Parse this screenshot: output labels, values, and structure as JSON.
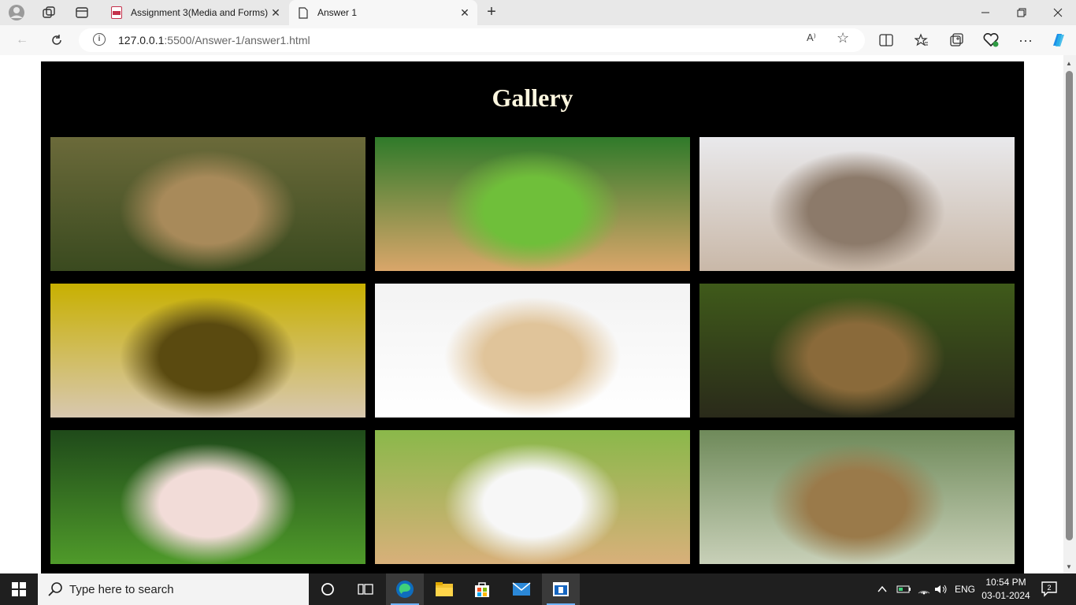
{
  "browser": {
    "tabs": [
      {
        "title": "Assignment 3(Media and Forms)",
        "active": false
      },
      {
        "title": "Answer 1",
        "active": true
      }
    ],
    "url_host": "127.0.0.1",
    "url_rest": ":5500/Answer-1/answer1.html",
    "read_aloud_label": "A⁾"
  },
  "page": {
    "heading": "Gallery",
    "images": [
      {
        "icon": "quokka-photo",
        "colors": [
          "#6b6a3a",
          "#a88a5a",
          "#3a4a1f"
        ]
      },
      {
        "icon": "kitten-in-grass-photo",
        "colors": [
          "#2f7a2a",
          "#6fbf3a",
          "#d9a66a"
        ]
      },
      {
        "icon": "hedgehog-photo",
        "colors": [
          "#e9e9ec",
          "#8c7a6a",
          "#c9b8a8"
        ]
      },
      {
        "icon": "corgi-in-hat-photo",
        "colors": [
          "#c8b000",
          "#5a4a10",
          "#d8c8b0"
        ]
      },
      {
        "icon": "puppy-and-kitten-sleeping-photo",
        "colors": [
          "#f3f3f3",
          "#e0c49a",
          "#ffffff"
        ]
      },
      {
        "icon": "puppy-and-kitten-photo",
        "colors": [
          "#3f5a1a",
          "#8a6a3a",
          "#2a2a1a"
        ]
      },
      {
        "icon": "piglet-photo",
        "colors": [
          "#1f4a1a",
          "#f2dcd8",
          "#4f9a2a"
        ]
      },
      {
        "icon": "bunnies-photo",
        "colors": [
          "#8ab84a",
          "#f7f7f7",
          "#d8b07a"
        ]
      },
      {
        "icon": "giraffe-photo",
        "colors": [
          "#6f8a5a",
          "#9a7a4a",
          "#c8d0b8"
        ]
      }
    ]
  },
  "taskbar": {
    "search_placeholder": "Type here to search",
    "language": "ENG",
    "time": "10:54 PM",
    "date": "03-01-2024",
    "notification_count": "2"
  },
  "colors": {
    "edge_accent": "#0f6cbd",
    "page_background": "#000000",
    "heading_color": "#fff8e0"
  }
}
